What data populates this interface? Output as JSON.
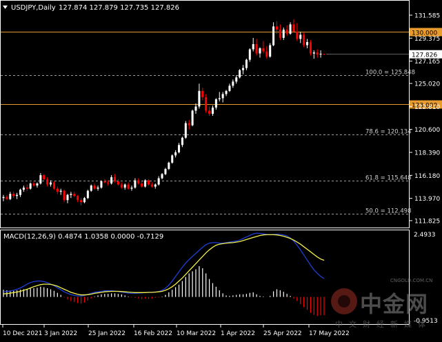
{
  "header": {
    "symbol": "USDJPY,Daily",
    "ohlc": "127.874 127.879 127.735 127.826"
  },
  "macd_header": "MACD(12,26,9) 0.4874 1.0358 0.0000 -0.7129",
  "price_axis_labels": [
    "131.585",
    "129.375",
    "127.165",
    "125.020",
    "122.810",
    "120.600",
    "118.390",
    "116.180",
    "113.970",
    "111.825"
  ],
  "price_axis_range": [
    111.825,
    131.585
  ],
  "current_price_label": "127.826",
  "current_price": 127.826,
  "level_lines": [
    {
      "label": "130.000",
      "value": 130.0,
      "color": "#e89b2e"
    },
    {
      "label": "123.000",
      "value": 123.0,
      "color": "#e89b2e"
    }
  ],
  "fib_lines": [
    {
      "label": "100.0 = 125.848",
      "value": 125.848
    },
    {
      "label": "78.6 = 120.134",
      "value": 120.134
    },
    {
      "label": "61.8 = 115.648",
      "value": 115.648
    },
    {
      "label": "50.0 = 112.498",
      "value": 112.498
    }
  ],
  "macd_axis_labels": {
    "top": "2.4933",
    "bottom": "-0.9513"
  },
  "macd_range": [
    -0.9513,
    2.4933
  ],
  "time_axis_labels": [
    "10 Dec 2021",
    "3 Jan 2022",
    "25 Jan 2022",
    "16 Feb 2022",
    "10 Mar 2022",
    "1 Apr 2022",
    "25 Apr 2022",
    "17 May 2022"
  ],
  "colors": {
    "background": "#000000",
    "up_candle": "#ffffff",
    "down_candle": "#ff0000",
    "level_line": "#e89b2e",
    "grid_dashed": "#cfcfcf",
    "macd_line": "#1f3fd6",
    "signal_line": "#f2ef4a",
    "hist_pos": "#ffffff",
    "hist_neg": "#ff0000",
    "text": "#ffffff"
  },
  "watermark": {
    "brand": "中金网",
    "url": "CNGOLD.COM.CN",
    "tagline": "中文财经新媒体"
  },
  "chart_data": {
    "type": "candlestick",
    "title": "USDJPY,Daily",
    "candles": [
      [
        114.0,
        114.3,
        113.7,
        114.1
      ],
      [
        114.1,
        114.3,
        113.8,
        113.9
      ],
      [
        113.9,
        114.6,
        113.8,
        114.4
      ],
      [
        114.4,
        114.6,
        114.0,
        114.2
      ],
      [
        114.2,
        114.5,
        113.9,
        114.3
      ],
      [
        114.3,
        114.9,
        114.1,
        114.8
      ],
      [
        114.8,
        115.2,
        114.6,
        115.0
      ],
      [
        115.0,
        115.3,
        114.7,
        114.9
      ],
      [
        114.9,
        115.5,
        114.8,
        115.4
      ],
      [
        115.4,
        115.6,
        115.1,
        115.2
      ],
      [
        115.2,
        115.5,
        115.0,
        115.4
      ],
      [
        115.4,
        116.4,
        115.3,
        116.2
      ],
      [
        116.2,
        116.3,
        115.7,
        115.8
      ],
      [
        115.8,
        116.0,
        115.1,
        115.3
      ],
      [
        115.3,
        115.7,
        115.1,
        115.5
      ],
      [
        115.5,
        115.6,
        114.8,
        114.9
      ],
      [
        114.9,
        115.1,
        114.4,
        114.6
      ],
      [
        114.6,
        114.9,
        114.3,
        114.7
      ],
      [
        114.7,
        114.8,
        113.6,
        113.8
      ],
      [
        113.8,
        114.4,
        113.5,
        114.3
      ],
      [
        114.3,
        114.6,
        114.0,
        114.4
      ],
      [
        114.4,
        114.6,
        114.1,
        114.2
      ],
      [
        114.2,
        114.3,
        113.6,
        113.8
      ],
      [
        113.8,
        114.0,
        113.3,
        113.6
      ],
      [
        113.6,
        114.1,
        113.5,
        114.0
      ],
      [
        114.0,
        114.8,
        113.9,
        114.7
      ],
      [
        114.7,
        115.3,
        114.6,
        115.2
      ],
      [
        115.2,
        115.4,
        114.8,
        114.9
      ],
      [
        114.9,
        115.2,
        114.7,
        115.0
      ],
      [
        115.0,
        115.7,
        114.9,
        115.6
      ],
      [
        115.6,
        115.8,
        115.4,
        115.5
      ],
      [
        115.5,
        115.7,
        115.2,
        115.4
      ],
      [
        115.4,
        116.2,
        115.3,
        116.0
      ],
      [
        116.0,
        116.3,
        115.5,
        115.6
      ],
      [
        115.6,
        115.8,
        115.2,
        115.3
      ],
      [
        115.3,
        115.5,
        114.9,
        115.0
      ],
      [
        115.0,
        115.4,
        114.8,
        115.3
      ],
      [
        115.3,
        115.5,
        114.8,
        114.9
      ],
      [
        114.9,
        115.2,
        114.7,
        115.0
      ],
      [
        115.0,
        115.9,
        114.9,
        115.7
      ],
      [
        115.7,
        115.9,
        115.3,
        115.4
      ],
      [
        115.4,
        115.6,
        115.0,
        115.1
      ],
      [
        115.1,
        115.8,
        115.0,
        115.7
      ],
      [
        115.7,
        115.8,
        115.2,
        115.3
      ],
      [
        115.3,
        115.5,
        115.0,
        115.1
      ],
      [
        115.1,
        115.4,
        114.9,
        115.3
      ],
      [
        115.3,
        116.1,
        115.2,
        115.9
      ],
      [
        115.9,
        116.4,
        115.8,
        116.3
      ],
      [
        116.3,
        116.9,
        116.2,
        116.8
      ],
      [
        116.8,
        117.5,
        116.7,
        117.4
      ],
      [
        117.4,
        118.2,
        117.3,
        118.1
      ],
      [
        118.1,
        118.6,
        117.9,
        118.4
      ],
      [
        118.4,
        119.3,
        118.3,
        119.1
      ],
      [
        119.1,
        119.9,
        118.9,
        119.8
      ],
      [
        119.8,
        121.4,
        119.7,
        121.2
      ],
      [
        121.2,
        121.5,
        120.6,
        121.0
      ],
      [
        121.0,
        122.5,
        120.9,
        122.4
      ],
      [
        122.4,
        123.1,
        122.1,
        122.8
      ],
      [
        122.8,
        125.0,
        122.6,
        124.3
      ],
      [
        124.3,
        124.6,
        123.4,
        123.7
      ],
      [
        123.7,
        124.0,
        122.2,
        122.4
      ],
      [
        122.4,
        122.8,
        121.9,
        122.1
      ],
      [
        122.1,
        122.9,
        121.9,
        122.7
      ],
      [
        122.7,
        123.6,
        122.5,
        123.5
      ],
      [
        123.5,
        124.2,
        123.3,
        123.6
      ],
      [
        123.6,
        124.2,
        123.2,
        124.0
      ],
      [
        124.0,
        124.4,
        123.8,
        124.3
      ],
      [
        124.3,
        125.0,
        124.2,
        124.8
      ],
      [
        124.8,
        125.4,
        124.6,
        125.2
      ],
      [
        125.2,
        125.8,
        125.0,
        125.6
      ],
      [
        125.6,
        126.4,
        125.5,
        126.3
      ],
      [
        126.3,
        126.8,
        125.9,
        126.5
      ],
      [
        126.5,
        127.4,
        126.3,
        127.3
      ],
      [
        127.3,
        128.4,
        127.1,
        128.3
      ],
      [
        128.3,
        129.4,
        128.1,
        128.8
      ],
      [
        128.8,
        129.3,
        127.7,
        127.9
      ],
      [
        127.9,
        128.5,
        127.5,
        128.4
      ],
      [
        128.4,
        129.1,
        127.9,
        128.1
      ],
      [
        128.1,
        128.6,
        127.4,
        127.6
      ],
      [
        127.6,
        128.9,
        127.5,
        128.7
      ],
      [
        128.7,
        130.9,
        128.6,
        130.5
      ],
      [
        130.5,
        131.0,
        129.8,
        130.2
      ],
      [
        130.2,
        130.7,
        129.2,
        129.4
      ],
      [
        129.4,
        130.4,
        129.2,
        130.2
      ],
      [
        130.2,
        130.6,
        129.6,
        129.8
      ],
      [
        129.8,
        130.9,
        129.7,
        130.7
      ],
      [
        130.7,
        131.2,
        129.9,
        130.0
      ],
      [
        130.0,
        130.8,
        129.1,
        129.3
      ],
      [
        129.3,
        130.0,
        128.9,
        129.7
      ],
      [
        129.7,
        129.9,
        128.5,
        128.7
      ],
      [
        128.7,
        129.3,
        128.4,
        129.0
      ],
      [
        129.0,
        129.2,
        127.7,
        127.9
      ],
      [
        127.9,
        128.2,
        127.4,
        128.0
      ],
      [
        128.0,
        128.3,
        127.5,
        127.8
      ],
      [
        127.8,
        128.2,
        127.5,
        127.874
      ],
      [
        127.874,
        127.879,
        127.735,
        127.826
      ]
    ],
    "macd_histogram": [
      0.28,
      0.26,
      0.25,
      0.24,
      0.26,
      0.28,
      0.3,
      0.31,
      0.33,
      0.34,
      0.36,
      0.4,
      0.38,
      0.34,
      0.3,
      0.24,
      0.16,
      0.08,
      -0.02,
      -0.1,
      -0.16,
      -0.2,
      -0.24,
      -0.26,
      -0.22,
      -0.14,
      -0.06,
      0.02,
      0.06,
      0.1,
      0.12,
      0.12,
      0.14,
      0.14,
      0.12,
      0.1,
      0.06,
      0.02,
      -0.02,
      -0.04,
      -0.06,
      -0.08,
      -0.06,
      -0.08,
      -0.06,
      -0.04,
      -0.02,
      0.02,
      0.08,
      0.18,
      0.28,
      0.38,
      0.48,
      0.62,
      0.78,
      0.92,
      1.0,
      1.08,
      1.2,
      1.12,
      0.92,
      0.7,
      0.54,
      0.4,
      0.26,
      0.14,
      0.06,
      0.04,
      0.06,
      0.08,
      0.1,
      0.1,
      0.12,
      0.16,
      0.18,
      0.1,
      0.04,
      0.02,
      0.0,
      0.04,
      0.22,
      0.3,
      0.26,
      0.2,
      0.12,
      0.04,
      -0.06,
      -0.16,
      -0.28,
      -0.4,
      -0.5,
      -0.62,
      -0.7,
      -0.74,
      -0.72,
      -0.71
    ],
    "macd_line": [
      0.2,
      0.21,
      0.23,
      0.26,
      0.3,
      0.35,
      0.42,
      0.5,
      0.56,
      0.6,
      0.62,
      0.62,
      0.6,
      0.56,
      0.5,
      0.44,
      0.36,
      0.28,
      0.2,
      0.14,
      0.09,
      0.06,
      0.04,
      0.04,
      0.06,
      0.1,
      0.14,
      0.18,
      0.2,
      0.22,
      0.24,
      0.24,
      0.24,
      0.23,
      0.21,
      0.19,
      0.17,
      0.15,
      0.14,
      0.14,
      0.15,
      0.16,
      0.17,
      0.18,
      0.18,
      0.19,
      0.21,
      0.26,
      0.34,
      0.46,
      0.62,
      0.8,
      0.98,
      1.16,
      1.32,
      1.46,
      1.58,
      1.7,
      1.82,
      1.94,
      2.04,
      2.1,
      2.12,
      2.12,
      2.1,
      2.1,
      2.12,
      2.14,
      2.16,
      2.18,
      2.22,
      2.28,
      2.34,
      2.4,
      2.46,
      2.49,
      2.48,
      2.46,
      2.44,
      2.43,
      2.44,
      2.45,
      2.44,
      2.42,
      2.38,
      2.3,
      2.18,
      2.02,
      1.84,
      1.64,
      1.44,
      1.24,
      1.06,
      0.92,
      0.8,
      0.72
    ],
    "signal_line": [
      0.12,
      0.13,
      0.15,
      0.17,
      0.19,
      0.22,
      0.26,
      0.3,
      0.35,
      0.4,
      0.44,
      0.48,
      0.5,
      0.5,
      0.49,
      0.46,
      0.42,
      0.36,
      0.3,
      0.24,
      0.18,
      0.14,
      0.1,
      0.08,
      0.08,
      0.09,
      0.11,
      0.14,
      0.16,
      0.18,
      0.2,
      0.21,
      0.22,
      0.22,
      0.22,
      0.21,
      0.2,
      0.19,
      0.18,
      0.17,
      0.17,
      0.17,
      0.17,
      0.18,
      0.18,
      0.19,
      0.2,
      0.22,
      0.26,
      0.32,
      0.4,
      0.5,
      0.62,
      0.74,
      0.88,
      1.02,
      1.16,
      1.3,
      1.44,
      1.58,
      1.72,
      1.84,
      1.94,
      2.02,
      2.06,
      2.08,
      2.1,
      2.11,
      2.12,
      2.14,
      2.16,
      2.2,
      2.24,
      2.28,
      2.32,
      2.36,
      2.4,
      2.42,
      2.43,
      2.43,
      2.43,
      2.42,
      2.4,
      2.37,
      2.33,
      2.28,
      2.22,
      2.14,
      2.06,
      1.96,
      1.86,
      1.76,
      1.66,
      1.56,
      1.48,
      1.43
    ]
  }
}
